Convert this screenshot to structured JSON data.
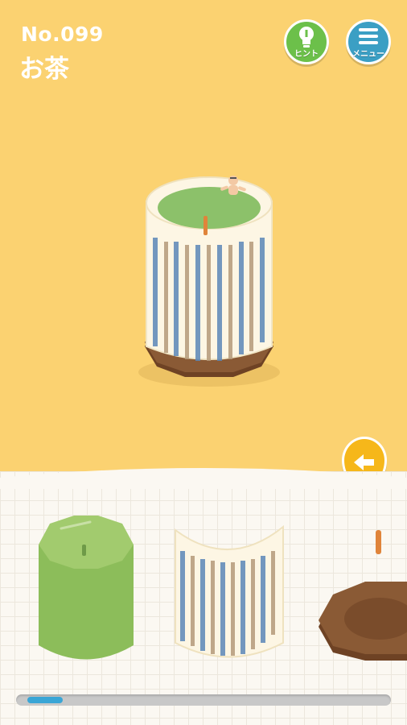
{
  "level": {
    "number": "No.099",
    "name": "お茶"
  },
  "buttons": {
    "hint_label": "ヒント",
    "menu_label": "メニュー"
  },
  "colors": {
    "background": "#fbd271",
    "tray": "#fbf8f2",
    "tea": "#8cc16a",
    "cup_stripe_blue": "#5b87b8",
    "cup_stripe_brown": "#b59a7a",
    "saucer": "#7a4e2e",
    "hint": "#6cc04a",
    "menu": "#3b9fc4",
    "back": "#f6b71a",
    "progress": "#3aa6d6"
  },
  "icons": [
    "lightbulb-icon",
    "hamburger-menu-icon",
    "back-arrow-icon"
  ],
  "pieces": [
    {
      "name": "green-tea-block"
    },
    {
      "name": "striped-cup"
    },
    {
      "name": "stick"
    },
    {
      "name": "wooden-saucer"
    }
  ],
  "progress": {
    "fraction": 0.1
  }
}
